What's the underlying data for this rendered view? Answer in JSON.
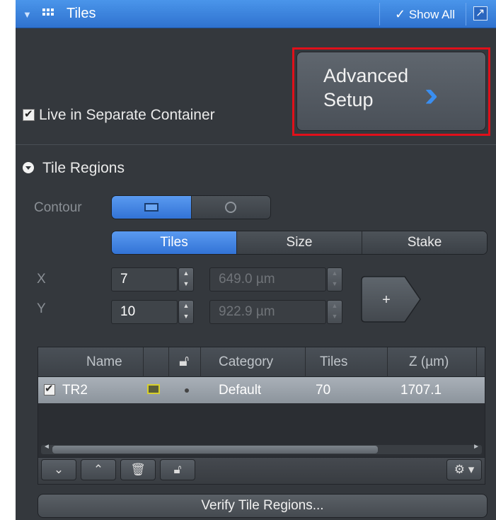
{
  "header": {
    "title": "Tiles",
    "show_all_label": "Show All"
  },
  "advanced_setup": {
    "line1": "Advanced",
    "line2": "Setup"
  },
  "live_separate": {
    "label": "Live in Separate Container",
    "checked": true
  },
  "tile_regions": {
    "heading": "Tile Regions",
    "contour_label": "Contour",
    "contour_options": [
      "rectangle",
      "circle"
    ],
    "mode_tabs": [
      "Tiles",
      "Size",
      "Stake"
    ],
    "active_tab": "Tiles",
    "x_label": "X",
    "y_label": "Y",
    "x_value": "7",
    "y_value": "10",
    "x_size": "649.0 µm",
    "y_size": "922.9 µm",
    "add_label": "+"
  },
  "table": {
    "columns": [
      "Name",
      "",
      "",
      "Category",
      "Tiles",
      "Z (µm)"
    ],
    "rows": [
      {
        "checked": true,
        "name": "TR2",
        "category": "Default",
        "tiles": "70",
        "z": "1707.1"
      }
    ]
  },
  "verify_label": "Verify Tile Regions...",
  "colors": {
    "header_blue": "#3a82de",
    "panel_bg": "#34383d",
    "highlight_red": "#e0101a",
    "accent_blue": "#3a8ef0"
  }
}
